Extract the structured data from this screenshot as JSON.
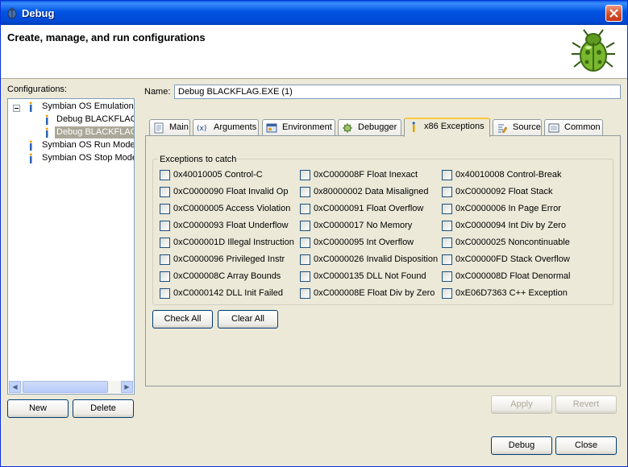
{
  "window": {
    "title": "Debug",
    "icon": "debug-bug-icon"
  },
  "header": {
    "title": "Create, manage, and run configurations",
    "icon": "green-bug-icon"
  },
  "configurations": {
    "label": "Configurations:",
    "items": [
      {
        "label": "Symbian OS Emulation",
        "expanded": true
      },
      {
        "label": "Debug BLACKFLAG.",
        "indent": 1
      },
      {
        "label": "Debug BLACKFLAG.",
        "indent": 1,
        "selected": true
      },
      {
        "label": "Symbian OS Run Mode"
      },
      {
        "label": "Symbian OS Stop Mode"
      }
    ]
  },
  "name_field": {
    "label": "Name:",
    "value": "Debug BLACKFLAG.EXE (1)"
  },
  "tabs": [
    {
      "label": "Main",
      "icon": "page-icon"
    },
    {
      "label": "Arguments",
      "icon": "variable-icon"
    },
    {
      "label": "Environment",
      "icon": "environment-icon"
    },
    {
      "label": "Debugger",
      "icon": "gear-bug-icon"
    },
    {
      "label": "x86 Exceptions",
      "icon": "exceptions-icon",
      "active": true
    },
    {
      "label": "Source",
      "icon": "source-icon"
    },
    {
      "label": "Common",
      "icon": "common-icon"
    }
  ],
  "exceptions": {
    "group_title": "Exceptions to catch",
    "columns": [
      [
        "0x40010005 Control-C",
        "0xC0000090 Float Invalid Op",
        "0xC0000005 Access Violation",
        "0xC0000093 Float Underflow",
        "0xC000001D Illegal Instruction",
        "0xC0000096 Privileged Instr",
        "0xC000008C Array Bounds",
        "0xC0000142 DLL Init Failed"
      ],
      [
        "0xC000008F Float Inexact",
        "0x80000002 Data Misaligned",
        "0xC0000091 Float Overflow",
        "0xC0000017 No Memory",
        "0xC0000095 Int Overflow",
        "0xC0000026 Invalid Disposition",
        "0xC0000135 DLL Not Found",
        "0xC000008E Float Div by Zero"
      ],
      [
        "0x40010008 Control-Break",
        "0xC0000092 Float Stack",
        "0xC0000006 In Page Error",
        "0xC0000094 Int Div by Zero",
        "0xC0000025 Noncontinuable",
        "0xC00000FD Stack Overflow",
        "0xC000008D Float Denormal",
        "0xE06D7363 C++ Exception"
      ]
    ],
    "check_all": "Check All",
    "clear_all": "Clear All"
  },
  "buttons": {
    "new": "New",
    "delete": "Delete",
    "apply": "Apply",
    "revert": "Revert",
    "debug": "Debug",
    "close": "Close"
  },
  "colors": {
    "title_bar": "#0054e3",
    "dialog_bg": "#ece9d8",
    "selection": "#aca899",
    "active_tab_accent": "#ffc83c"
  }
}
